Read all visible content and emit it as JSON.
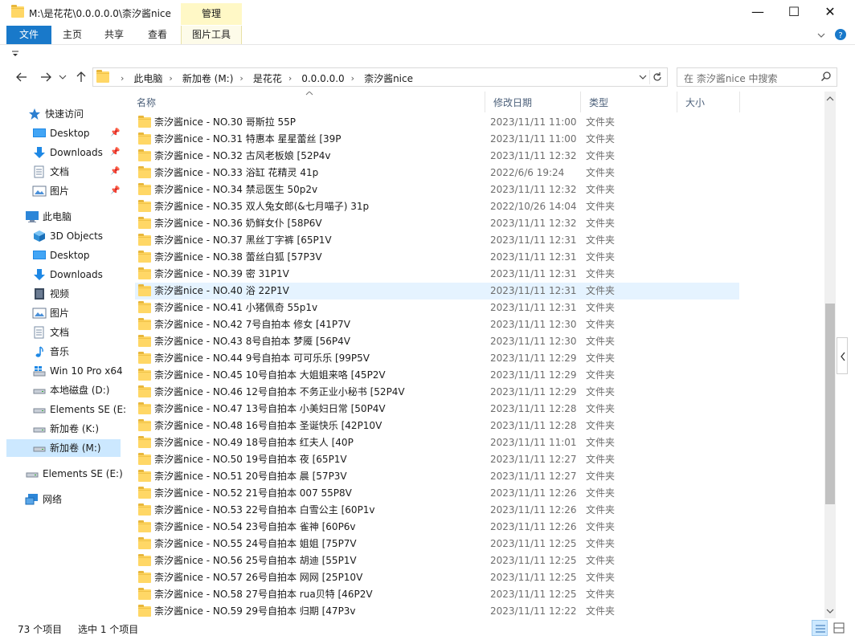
{
  "window": {
    "title": "M:\\是花花\\0.0.0.0.0\\柰汐酱nice",
    "manage_tab": "管理",
    "minimize_glyph": "—",
    "maximize_glyph": "☐",
    "close_glyph": "✕"
  },
  "ribbon": {
    "tabs": [
      "文件",
      "主页",
      "共享",
      "查看",
      "图片工具"
    ]
  },
  "address": {
    "crumbs": [
      "此电脑",
      "新加卷 (M:)",
      "是花花",
      "0.0.0.0.0",
      "柰汐酱nice"
    ]
  },
  "search": {
    "placeholder": "在 柰汐酱nice 中搜索"
  },
  "nav": {
    "quick_access": "快速访问",
    "quick_items": [
      "Desktop",
      "Downloads",
      "文档",
      "图片"
    ],
    "this_pc": "此电脑",
    "pc_items": [
      "3D Objects",
      "Desktop",
      "Downloads",
      "视频",
      "图片",
      "文档",
      "音乐",
      "Win 10 Pro x64",
      "本地磁盘 (D:)",
      "Elements SE (E:",
      "新加卷 (K:)",
      "新加卷 (M:)"
    ],
    "elements_root": "Elements SE (E:)",
    "network": "网络"
  },
  "columns": {
    "name": "名称",
    "date": "修改日期",
    "type": "类型",
    "size": "大小"
  },
  "rows": [
    {
      "name": "柰汐酱nice - NO.30 哥斯拉 55P",
      "date": "2023/11/11 11:00",
      "type": "文件夹"
    },
    {
      "name": "柰汐酱nice - NO.31 特惠本 星星蕾丝 [39P",
      "date": "2023/11/11 11:00",
      "type": "文件夹"
    },
    {
      "name": "柰汐酱nice - NO.32 古风老板娘 [52P4v",
      "date": "2023/11/11 12:32",
      "type": "文件夹"
    },
    {
      "name": "柰汐酱nice - NO.33 浴缸 花精灵 41p",
      "date": "2022/6/6 19:24",
      "type": "文件夹"
    },
    {
      "name": "柰汐酱nice - NO.34 禁忌医生 50p2v",
      "date": "2023/11/11 12:32",
      "type": "文件夹"
    },
    {
      "name": "柰汐酱nice - NO.35 双人兔女郎(&七月喵子) 31p",
      "date": "2022/10/26 14:04",
      "type": "文件夹"
    },
    {
      "name": "柰汐酱nice - NO.36 奶鲜女仆 [58P6V",
      "date": "2023/11/11 12:32",
      "type": "文件夹"
    },
    {
      "name": "柰汐酱nice - NO.37 黑丝丁字裤 [65P1V",
      "date": "2023/11/11 12:31",
      "type": "文件夹"
    },
    {
      "name": "柰汐酱nice - NO.38 蕾丝白狐 [57P3V",
      "date": "2023/11/11 12:31",
      "type": "文件夹"
    },
    {
      "name": "柰汐酱nice - NO.39 密 31P1V",
      "date": "2023/11/11 12:31",
      "type": "文件夹"
    },
    {
      "name": "柰汐酱nice - NO.40 浴 22P1V",
      "date": "2023/11/11 12:31",
      "type": "文件夹"
    },
    {
      "name": "柰汐酱nice - NO.41 小猪佩奇 55p1v",
      "date": "2023/11/11 12:31",
      "type": "文件夹"
    },
    {
      "name": "柰汐酱nice - NO.42 7号自拍本 修女 [41P7V",
      "date": "2023/11/11 12:30",
      "type": "文件夹"
    },
    {
      "name": "柰汐酱nice - NO.43 8号自拍本 梦魇 [56P4V",
      "date": "2023/11/11 12:30",
      "type": "文件夹"
    },
    {
      "name": "柰汐酱nice - NO.44 9号自拍本 可可乐乐 [99P5V",
      "date": "2023/11/11 12:29",
      "type": "文件夹"
    },
    {
      "name": "柰汐酱nice - NO.45 10号自拍本 大姐姐来咯 [45P2V",
      "date": "2023/11/11 12:29",
      "type": "文件夹"
    },
    {
      "name": "柰汐酱nice - NO.46 12号自拍本 不务正业小秘书 [52P4V",
      "date": "2023/11/11 12:29",
      "type": "文件夹"
    },
    {
      "name": "柰汐酱nice - NO.47 13号自拍本 小美妇日常 [50P4V",
      "date": "2023/11/11 12:28",
      "type": "文件夹"
    },
    {
      "name": "柰汐酱nice - NO.48 16号自拍本 圣诞快乐 [42P10V",
      "date": "2023/11/11 12:28",
      "type": "文件夹"
    },
    {
      "name": "柰汐酱nice - NO.49 18号自拍本 红夫人 [40P",
      "date": "2023/11/11 11:01",
      "type": "文件夹"
    },
    {
      "name": "柰汐酱nice - NO.50 19号自拍本 夜 [65P1V",
      "date": "2023/11/11 12:27",
      "type": "文件夹"
    },
    {
      "name": "柰汐酱nice - NO.51 20号自拍本 晨 [57P3V",
      "date": "2023/11/11 12:27",
      "type": "文件夹"
    },
    {
      "name": "柰汐酱nice - NO.52 21号自拍本 007 55P8V",
      "date": "2023/11/11 12:26",
      "type": "文件夹"
    },
    {
      "name": "柰汐酱nice - NO.53 22号自拍本 白雪公主 [60P1v",
      "date": "2023/11/11 12:26",
      "type": "文件夹"
    },
    {
      "name": "柰汐酱nice - NO.54 23号自拍本 雀神 [60P6v",
      "date": "2023/11/11 12:26",
      "type": "文件夹"
    },
    {
      "name": "柰汐酱nice - NO.55 24号自拍本 姐姐 [75P7V",
      "date": "2023/11/11 12:25",
      "type": "文件夹"
    },
    {
      "name": "柰汐酱nice - NO.56 25号自拍本 胡迪 [55P1V",
      "date": "2023/11/11 12:25",
      "type": "文件夹"
    },
    {
      "name": "柰汐酱nice - NO.57 26号自拍本 网网 [25P10V",
      "date": "2023/11/11 12:25",
      "type": "文件夹"
    },
    {
      "name": "柰汐酱nice - NO.58 27号自拍本 rua贝特 [46P2V",
      "date": "2023/11/11 12:25",
      "type": "文件夹"
    },
    {
      "name": "柰汐酱nice - NO.59 29号自拍本 归期 [47P3v",
      "date": "2023/11/11 12:22",
      "type": "文件夹"
    }
  ],
  "status": {
    "count": "73 个项目",
    "selected": "选中 1 个项目"
  },
  "colors": {
    "accent": "#1979ca",
    "selection": "#cce8ff",
    "hover": "#e5f3ff",
    "folder": "#ffd766"
  },
  "icons": {
    "folder": "folder-icon",
    "search": "search-icon",
    "refresh": "refresh-icon",
    "star": "star-icon",
    "pc": "computer-icon",
    "network": "network-icon"
  }
}
